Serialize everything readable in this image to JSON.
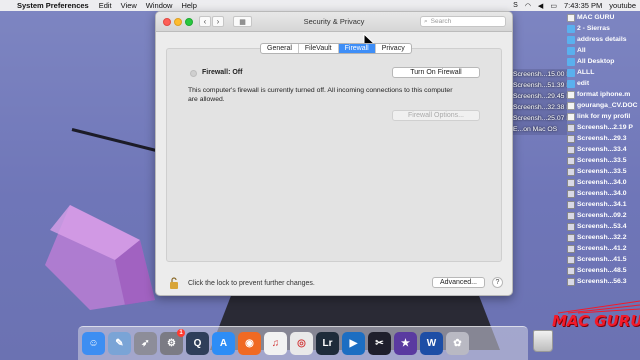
{
  "menubar": {
    "app": "System Preferences",
    "items": [
      "Edit",
      "View",
      "Window",
      "Help"
    ],
    "clock": "7:43:35 PM",
    "user": "youtube"
  },
  "window": {
    "title": "Security & Privacy",
    "search_placeholder": "Search",
    "tabs": [
      {
        "label": "General",
        "active": false
      },
      {
        "label": "FileVault",
        "active": false
      },
      {
        "label": "Firewall",
        "active": true
      },
      {
        "label": "Privacy",
        "active": false
      }
    ],
    "firewall": {
      "status": "Firewall: Off",
      "turn_on_label": "Turn On Firewall",
      "description": "This computer's firewall is currently turned off. All incoming connections to this computer are allowed.",
      "options_label": "Firewall Options..."
    },
    "lock_text": "Click the lock to prevent further changes.",
    "advanced_label": "Advanced...",
    "help_label": "?"
  },
  "middle_files": [
    "Screensh...15.00 PM",
    "Screensh...51.39 PM",
    "Screensh...29.45 PM",
    "Screensh...32.38 PM",
    "Screensh...25.07 PM",
    "E...on Mac OS"
  ],
  "desktop_items": [
    {
      "label": "MAC GURU",
      "icon": "doc-icon"
    },
    {
      "label": "2 - Sierras",
      "icon": "folder-icon"
    },
    {
      "label": "address details",
      "icon": "folder-icon"
    },
    {
      "label": "All",
      "icon": "folder-icon"
    },
    {
      "label": "All Desktop",
      "icon": "folder-icon"
    },
    {
      "label": "ALLL",
      "icon": "folder-icon"
    },
    {
      "label": "edit",
      "icon": "folder-icon"
    },
    {
      "label": "format iphone.m",
      "icon": "doc-icon"
    },
    {
      "label": "gouranga_CV.DOC",
      "icon": "doc-icon"
    },
    {
      "label": "link for my profil",
      "icon": "doc-icon"
    },
    {
      "label": "Screensh...2.19 P",
      "icon": "screenshot-icon"
    },
    {
      "label": "Screensh...29.3",
      "icon": "screenshot-icon"
    },
    {
      "label": "Screensh...33.4",
      "icon": "screenshot-icon"
    },
    {
      "label": "Screensh...33.5",
      "icon": "screenshot-icon"
    },
    {
      "label": "Screensh...33.5",
      "icon": "screenshot-icon"
    },
    {
      "label": "Screensh...34.0",
      "icon": "screenshot-icon"
    },
    {
      "label": "Screensh...34.0",
      "icon": "screenshot-icon"
    },
    {
      "label": "Screensh...34.1",
      "icon": "screenshot-icon"
    },
    {
      "label": "Screensh...09.2",
      "icon": "screenshot-icon"
    },
    {
      "label": "Screensh...53.4",
      "icon": "screenshot-icon"
    },
    {
      "label": "Screensh...32.2",
      "icon": "screenshot-icon"
    },
    {
      "label": "Screensh...41.2",
      "icon": "screenshot-icon"
    },
    {
      "label": "Screensh...41.5",
      "icon": "screenshot-icon"
    },
    {
      "label": "Screensh...48.5",
      "icon": "screenshot-icon"
    },
    {
      "label": "Screensh...56.3",
      "icon": "screenshot-icon"
    }
  ],
  "logo_text": "MAC GURU",
  "dock": [
    {
      "name": "finder-icon",
      "color": "#3d8ef2",
      "glyph": "☺"
    },
    {
      "name": "preview-icon",
      "color": "#7aa4d6",
      "glyph": "✎"
    },
    {
      "name": "launchpad-icon",
      "color": "#8d8d99",
      "glyph": "➶"
    },
    {
      "name": "system-preferences-icon",
      "color": "#7b7b84",
      "glyph": "⚙",
      "badge": "1"
    },
    {
      "name": "quicktime-icon",
      "color": "#2f3f5a",
      "glyph": "Q"
    },
    {
      "name": "app-store-icon",
      "color": "#2d8df6",
      "glyph": "A"
    },
    {
      "name": "firefox-icon",
      "color": "#f06a23",
      "glyph": "◉"
    },
    {
      "name": "itunes-icon",
      "color": "#f2f2f2",
      "glyph": "♫"
    },
    {
      "name": "chrome-icon",
      "color": "#e9e9e9",
      "glyph": "◎"
    },
    {
      "name": "lightroom-icon",
      "color": "#1e2b3a",
      "glyph": "Lr"
    },
    {
      "name": "screenflow-icon",
      "color": "#1c6ec2",
      "glyph": "▶"
    },
    {
      "name": "final-cut-icon",
      "color": "#1f1f2c",
      "glyph": "✂"
    },
    {
      "name": "imovie-icon",
      "color": "#5a3aa0",
      "glyph": "★"
    },
    {
      "name": "word-icon",
      "color": "#1d4ea6",
      "glyph": "W"
    },
    {
      "name": "photo-booth-icon",
      "color": "#b9b9c3",
      "glyph": "✿"
    }
  ]
}
